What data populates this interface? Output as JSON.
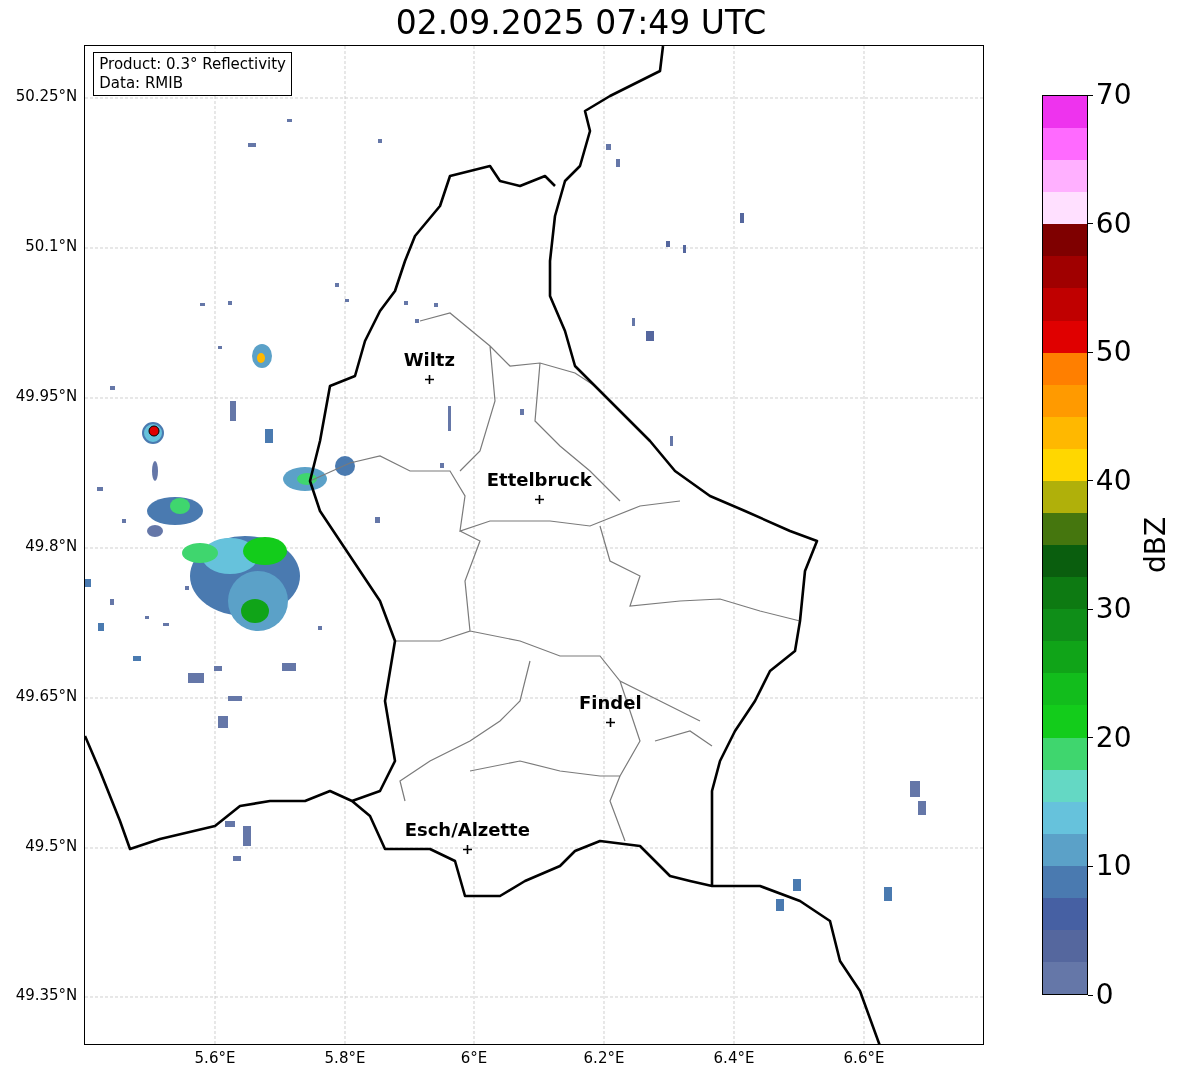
{
  "title": "02.09.2025 07:49 UTC",
  "info_box": {
    "lines": [
      "Product: 0.3° Reflectivity",
      "Data: RMIB"
    ]
  },
  "map": {
    "lat_labels": [
      "50.25°N",
      "50.1°N",
      "49.95°N",
      "49.8°N",
      "49.65°N",
      "49.5°N",
      "49.35°N"
    ],
    "lon_labels": [
      "5.6°E",
      "5.8°E",
      "6°E",
      "6.2°E",
      "6.4°E",
      "6.6°E"
    ],
    "cities": [
      {
        "name": "Wiltz"
      },
      {
        "name": "Ettelbruck"
      },
      {
        "name": "Findel"
      },
      {
        "name": "Esch/Alzette"
      }
    ]
  },
  "colorbar": {
    "label": "dBZ",
    "ticks": [
      "70",
      "60",
      "50",
      "40",
      "30",
      "20",
      "10",
      "0"
    ],
    "bands": [
      {
        "color": "#ee33ee"
      },
      {
        "color": "#ff6aff"
      },
      {
        "color": "#ffb0ff"
      },
      {
        "color": "#ffe0ff"
      },
      {
        "color": "#7f0000"
      },
      {
        "color": "#a00000"
      },
      {
        "color": "#c00000"
      },
      {
        "color": "#e00000"
      },
      {
        "color": "#ff7f00"
      },
      {
        "color": "#ff9a00"
      },
      {
        "color": "#ffb800"
      },
      {
        "color": "#ffd700"
      },
      {
        "color": "#b0b00a"
      },
      {
        "color": "#45760e"
      },
      {
        "color": "#0a5e0e"
      },
      {
        "color": "#0d7a12"
      },
      {
        "color": "#0f8e18"
      },
      {
        "color": "#10a418"
      },
      {
        "color": "#12bd1c"
      },
      {
        "color": "#13cc1b"
      },
      {
        "color": "#3fd66e"
      },
      {
        "color": "#64d8c4"
      },
      {
        "color": "#66c2dc"
      },
      {
        "color": "#5ba1c8"
      },
      {
        "color": "#4a7ab0"
      },
      {
        "color": "#4660a3"
      },
      {
        "color": "#55679e"
      },
      {
        "color": "#6577a8"
      }
    ]
  }
}
